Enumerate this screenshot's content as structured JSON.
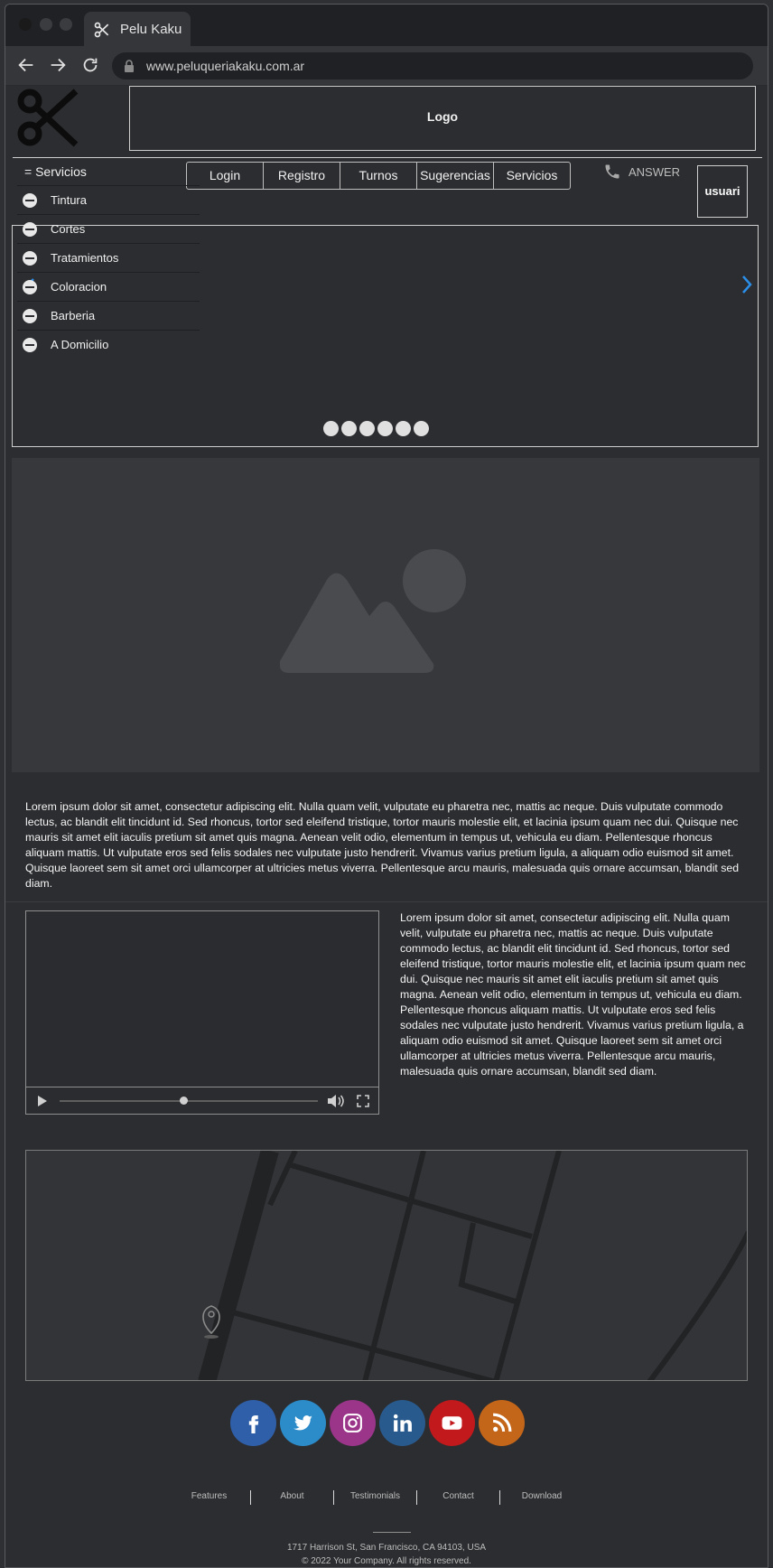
{
  "browser": {
    "tab_title": "Pelu Kaku",
    "url": "www.peluqueriakaku.com.ar"
  },
  "header": {
    "logo_label": "Logo",
    "menu": [
      "Login",
      "Registro",
      "Turnos",
      "Sugerencias",
      "Servicios"
    ],
    "phone_label": "ANSWER",
    "user_label": "usuari"
  },
  "sidebar": {
    "title": "= Servicios",
    "items": [
      "Tintura",
      "Cortes",
      "Tratamientos",
      "Coloracion",
      "Barberia",
      "A Domicilio"
    ]
  },
  "carousel": {
    "slide_count": 6
  },
  "content": {
    "paragraph_1": "Lorem ipsum dolor sit amet, consectetur adipiscing elit. Nulla quam velit, vulputate eu pharetra nec, mattis ac neque. Duis vulputate commodo lectus, ac blandit elit tincidunt id. Sed rhoncus, tortor sed eleifend tristique, tortor mauris molestie elit, et lacinia ipsum quam nec dui. Quisque nec mauris sit amet elit iaculis pretium sit amet quis magna. Aenean velit odio, elementum in tempus ut, vehicula eu diam. Pellentesque rhoncus aliquam mattis. Ut vulputate eros sed felis sodales nec vulputate justo hendrerit. Vivamus varius pretium ligula, a aliquam odio euismod sit amet. Quisque laoreet sem sit amet orci ullamcorper at ultricies metus viverra. Pellentesque arcu mauris, malesuada quis ornare accumsan, blandit sed diam.",
    "paragraph_2": "Lorem ipsum dolor sit amet, consectetur adipiscing elit. Nulla quam velit, vulputate eu pharetra nec, mattis ac neque. Duis vulputate commodo lectus, ac blandit elit tincidunt id. Sed rhoncus, tortor sed eleifend tristique, tortor mauris molestie elit, et lacinia ipsum quam nec dui. Quisque nec mauris sit amet elit iaculis pretium sit amet quis magna. Aenean velit odio, elementum in tempus ut, vehicula eu diam. Pellentesque rhoncus aliquam mattis. Ut vulputate eros sed felis sodales nec vulputate justo hendrerit. Vivamus varius pretium ligula, a aliquam odio euismod sit amet. Quisque laoreet sem sit amet orci ullamcorper at ultricies metus viverra. Pellentesque arcu mauris, malesuada quis ornare accumsan, blandit sed diam."
  },
  "video": {
    "progress": 0.48
  },
  "footer": {
    "socials": [
      "facebook-icon",
      "twitter-icon",
      "instagram-icon",
      "linkedin-icon",
      "youtube-icon",
      "rss-icon"
    ],
    "links": [
      "Features",
      "About",
      "Testimonials",
      "Contact",
      "Download"
    ],
    "address": "1717 Harrison St, San Francisco, CA 94103, USA",
    "copyright": "© 2022 Your Company.  All rights reserved."
  }
}
